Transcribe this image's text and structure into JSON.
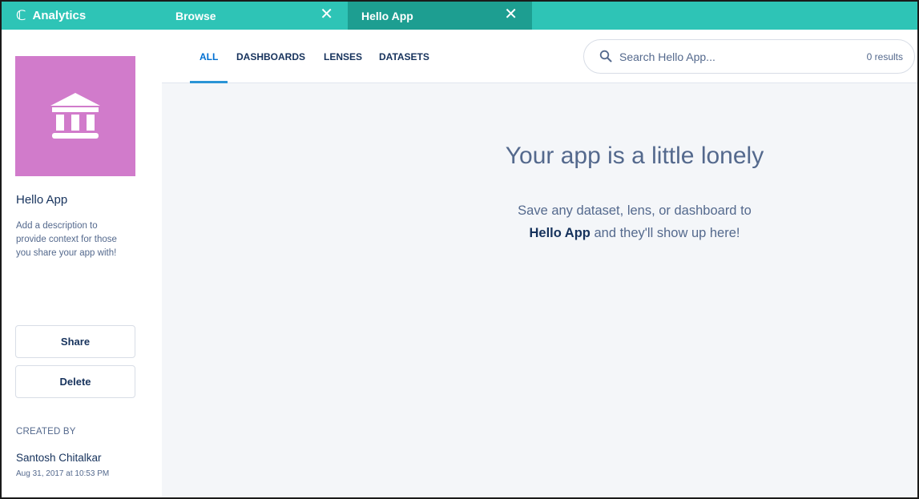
{
  "topbar": {
    "brand_label": "Analytics",
    "brand_logo": "ℂ",
    "tabs": [
      {
        "label": "Browse",
        "close": "✕"
      },
      {
        "label": "Hello App",
        "close": "✕",
        "active": true
      }
    ]
  },
  "sidebar": {
    "app_icon": "bank-icon",
    "app_icon_color": "#d17bcb",
    "app_name": "Hello App",
    "description": "Add a description to provide context for those you share your app with!",
    "share_label": "Share",
    "delete_label": "Delete",
    "created_by_label": "CREATED BY",
    "creator_name": "Santosh Chitalkar",
    "created_date": "Aug 31, 2017 at 10:53 PM"
  },
  "subnav": {
    "tabs": [
      {
        "label": "ALL",
        "active": true
      },
      {
        "label": "DASHBOARDS"
      },
      {
        "label": "LENSES"
      },
      {
        "label": "DATASETS"
      }
    ]
  },
  "search": {
    "placeholder": "Search Hello App...",
    "value": "",
    "result_count": "0 results"
  },
  "empty_state": {
    "title": "Your app is a little lonely",
    "line1": "Save any dataset, lens, or dashboard to",
    "app_name": "Hello App",
    "line2_suffix": " and they'll show up here!"
  },
  "colors": {
    "topbar": "#2ec4b6",
    "active_tab": "#1d9e91",
    "accent": "#0070d2",
    "main_bg": "#f4f6f9"
  }
}
